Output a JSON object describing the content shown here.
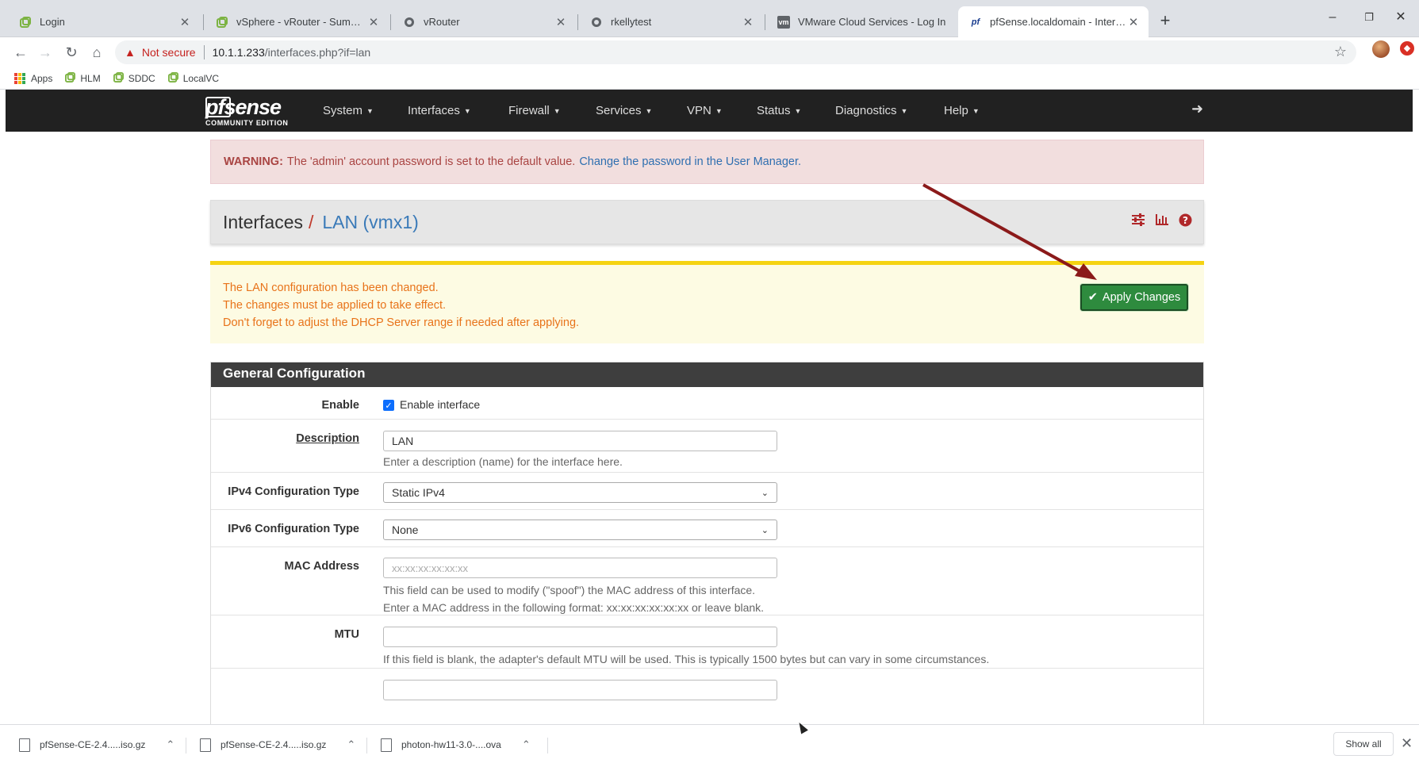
{
  "browser": {
    "tabs": [
      {
        "title": "Login",
        "favicon": "pfsense-favicon"
      },
      {
        "title": "vSphere - vRouter - Summary",
        "favicon": "vsphere-favicon"
      },
      {
        "title": "vRouter",
        "favicon": "globe-favicon"
      },
      {
        "title": "rkellytest",
        "favicon": "globe-favicon"
      },
      {
        "title": "VMware Cloud Services - Log In",
        "favicon": "vm-favicon"
      },
      {
        "title": "pfSense.localdomain - Interfaces",
        "favicon": "pfsense-favicon"
      }
    ],
    "new_tab": "+",
    "window_controls": {
      "minimize": "–",
      "restore": "❐",
      "close": "✕"
    },
    "address": {
      "security": "Not secure",
      "url_host": "10.1.1.233",
      "url_path": "/interfaces.php?if=lan"
    },
    "bookmarks": [
      {
        "label": "Apps"
      },
      {
        "label": "HLM"
      },
      {
        "label": "SDDC"
      },
      {
        "label": "LocalVC"
      }
    ]
  },
  "pfsense": {
    "logo_text": "sense",
    "logo_prefix": "pf",
    "logo_subtitle": "COMMUNITY EDITION",
    "menu": [
      "System",
      "Interfaces",
      "Firewall",
      "Services",
      "VPN",
      "Status",
      "Diagnostics",
      "Help"
    ],
    "warning": {
      "label": "WARNING:",
      "text": "The 'admin' account password is set to the default value.",
      "link": "Change the password in the User Manager."
    },
    "breadcrumb": {
      "parent": "Interfaces",
      "separator": "/",
      "current": "LAN (vmx1)"
    },
    "apply_notice": {
      "lines": [
        "The LAN configuration has been changed.",
        "The changes must be applied to take effect.",
        "Don't forget to adjust the DHCP Server range if needed after applying."
      ],
      "button": "Apply Changes"
    },
    "general_config": {
      "heading": "General Configuration",
      "enable": {
        "label": "Enable",
        "checkbox_label": "Enable interface",
        "checked": true
      },
      "description": {
        "label": "Description",
        "value": "LAN",
        "help": "Enter a description (name) for the interface here."
      },
      "ipv4": {
        "label": "IPv4 Configuration Type",
        "value": "Static IPv4"
      },
      "ipv6": {
        "label": "IPv6 Configuration Type",
        "value": "None"
      },
      "mac": {
        "label": "MAC Address",
        "placeholder": "xx:xx:xx:xx:xx:xx",
        "help1": "This field can be used to modify (\"spoof\") the MAC address of this interface.",
        "help2": "Enter a MAC address in the following format: xx:xx:xx:xx:xx:xx or leave blank."
      },
      "mtu": {
        "label": "MTU",
        "value": "",
        "help": "If this field is blank, the adapter's default MTU will be used. This is typically 1500 bytes but can vary in some circumstances."
      }
    }
  },
  "downloads": {
    "items": [
      "pfSense-CE-2.4.....iso.gz",
      "pfSense-CE-2.4.....iso.gz",
      "photon-hw11-3.0-....ova"
    ],
    "show_all": "Show all"
  },
  "colors": {
    "navbar": "#212121",
    "warning_bg": "#f2dede",
    "apply_bg": "#fdfbe3",
    "apply_border": "#f5d312",
    "apply_button": "#2e8b3e",
    "arrow": "#8b1a1a",
    "breadcrumb_link": "#3a7ab8"
  }
}
